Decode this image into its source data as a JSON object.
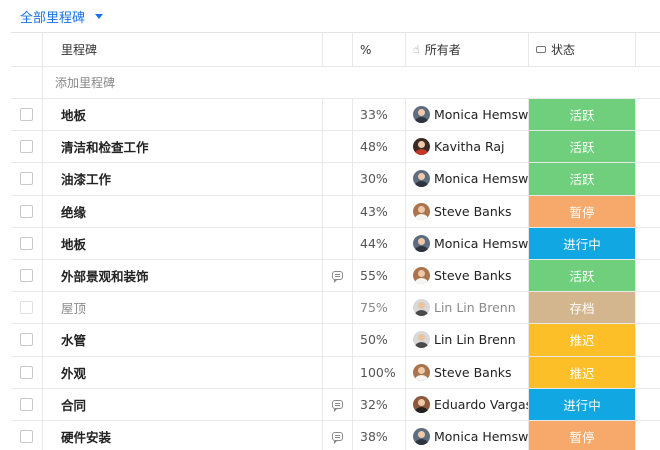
{
  "filter": {
    "label": "全部里程碑"
  },
  "header": {
    "name": "里程碑",
    "percent": "%",
    "owner": "所有者",
    "status": "状态"
  },
  "add_row": {
    "label": "添加里程碑"
  },
  "colors": {
    "活跃": "#6fcf7c",
    "暂停": "#f6a96a",
    "进行中": "#11a7e3",
    "存档": "#c59e68",
    "推迟": "#fcbf27"
  },
  "rows": [
    {
      "name": "地板",
      "comment": false,
      "percent": "33%",
      "owner": "Monica Hemsw",
      "avatar": "monica",
      "status": "活跃",
      "dim": false
    },
    {
      "name": "清洁和检查工作",
      "comment": false,
      "percent": "48%",
      "owner": "Kavitha Raj",
      "avatar": "kavitha",
      "status": "活跃",
      "dim": false
    },
    {
      "name": "油漆工作",
      "comment": false,
      "percent": "30%",
      "owner": "Monica Hemsw",
      "avatar": "monica",
      "status": "活跃",
      "dim": false
    },
    {
      "name": "绝缘",
      "comment": false,
      "percent": "43%",
      "owner": "Steve Banks",
      "avatar": "steve",
      "status": "暂停",
      "dim": false
    },
    {
      "name": "地板",
      "comment": false,
      "percent": "44%",
      "owner": "Monica Hemsw",
      "avatar": "monica",
      "status": "进行中",
      "dim": false
    },
    {
      "name": "外部景观和装饰",
      "comment": true,
      "percent": "55%",
      "owner": "Steve Banks",
      "avatar": "steve",
      "status": "活跃",
      "dim": false
    },
    {
      "name": "屋顶",
      "comment": false,
      "percent": "75%",
      "owner": "Lin Lin Brenn",
      "avatar": "lin",
      "status": "存档",
      "dim": true
    },
    {
      "name": "水管",
      "comment": false,
      "percent": "50%",
      "owner": "Lin Lin Brenn",
      "avatar": "lin",
      "status": "推迟",
      "dim": false
    },
    {
      "name": "外观",
      "comment": false,
      "percent": "100%",
      "owner": "Steve Banks",
      "avatar": "steve",
      "status": "推迟",
      "dim": false
    },
    {
      "name": "合同",
      "comment": true,
      "percent": "32%",
      "owner": "Eduardo Vargas",
      "avatar": "eduardo",
      "status": "进行中",
      "dim": false
    },
    {
      "name": "硬件安装",
      "comment": true,
      "percent": "38%",
      "owner": "Monica Hemsw",
      "avatar": "monica",
      "status": "暂停",
      "dim": false
    }
  ]
}
